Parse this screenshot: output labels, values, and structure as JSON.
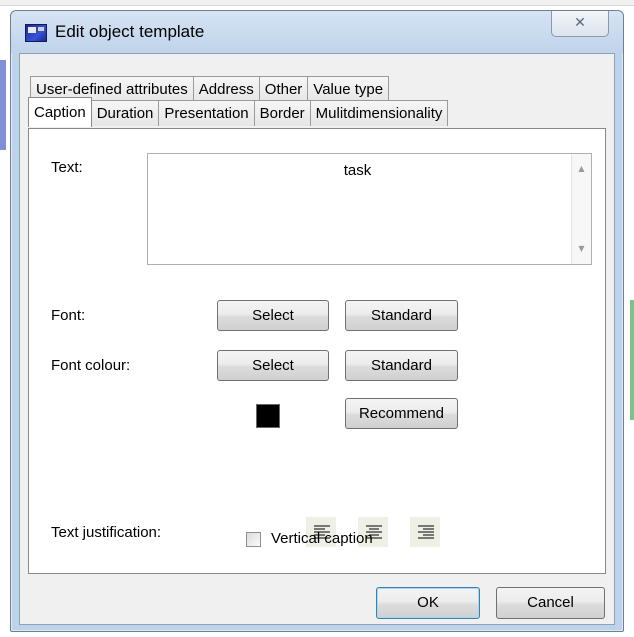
{
  "window": {
    "title": "Edit object template",
    "close_glyph": "✕"
  },
  "tabs": {
    "back_row": [
      {
        "label": "User-defined attributes"
      },
      {
        "label": "Address"
      },
      {
        "label": "Other"
      },
      {
        "label": "Value type"
      }
    ],
    "front_row": [
      {
        "label": "Caption",
        "active": true
      },
      {
        "label": "Duration"
      },
      {
        "label": "Presentation"
      },
      {
        "label": "Border"
      },
      {
        "label": "Mulitdimensionality"
      }
    ]
  },
  "caption": {
    "text_label": "Text:",
    "text_value": "task",
    "font_label": "Font:",
    "font_select": "Select",
    "font_standard": "Standard",
    "colour_label": "Font colour:",
    "colour_select": "Select",
    "colour_standard": "Standard",
    "colour_recommend": "Recommend",
    "colour_value": "#000000",
    "justification_label": "Text justification:",
    "justification_options": [
      "left-align-icon",
      "center-align-icon",
      "right-align-icon"
    ],
    "vertical_caption_label": "Vertical caption",
    "vertical_caption_checked": false
  },
  "footer": {
    "ok": "OK",
    "cancel": "Cancel"
  }
}
